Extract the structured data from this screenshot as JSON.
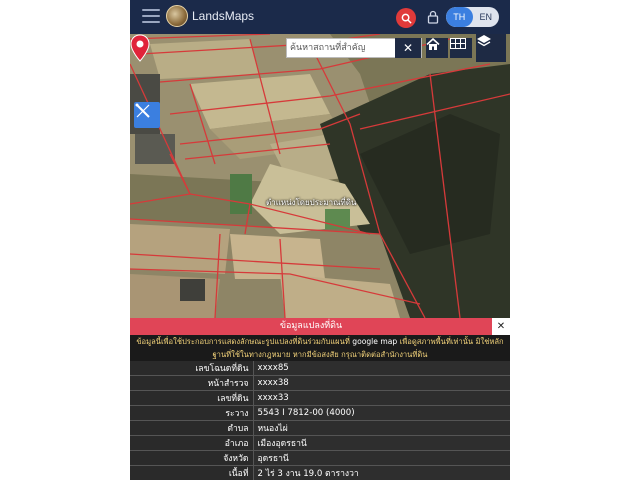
{
  "header": {
    "brand": "LandsMaps",
    "lang_th": "TH",
    "lang_en": "EN"
  },
  "map": {
    "search_placeholder": "ค้นหาสถานที่สำคัญ",
    "clear_label": "✕",
    "parcel_label": "ตำแหน่งโดยประมาณที่ดิน"
  },
  "panel": {
    "title": "ข้อมูลแปลงที่ดิน",
    "close_label": "✕",
    "notice_part1": "ข้อมูลนี้เพื่อใช้ประกอบการแสดงลักษณะรูปแปลงที่ดินร่วมกับแผนที่ ",
    "notice_hl": "google map",
    "notice_part2": " เพื่อดูสภาพพื้นที่เท่านั้น มิใช่หลักฐานที่ใช้ในทางกฎหมาย หากมีข้อสงสัย กรุณาติดต่อสำนักงานที่ดิน",
    "rows": [
      {
        "key": "เลขโฉนดที่ดิน",
        "value": "xxxx85"
      },
      {
        "key": "หน้าสำรวจ",
        "value": "xxxx38"
      },
      {
        "key": "เลขที่ดิน",
        "value": "xxxx33"
      },
      {
        "key": "ระวาง",
        "value": "5543 I 7812-00 (4000)"
      },
      {
        "key": "ตำบล",
        "value": "หนองไผ่"
      },
      {
        "key": "อำเภอ",
        "value": "เมืองอุดรธานี"
      },
      {
        "key": "จังหวัด",
        "value": "อุดรธานี"
      },
      {
        "key": "เนื้อที่",
        "value": "2 ไร่ 3 งาน 19.0 ตารางวา"
      }
    ]
  }
}
